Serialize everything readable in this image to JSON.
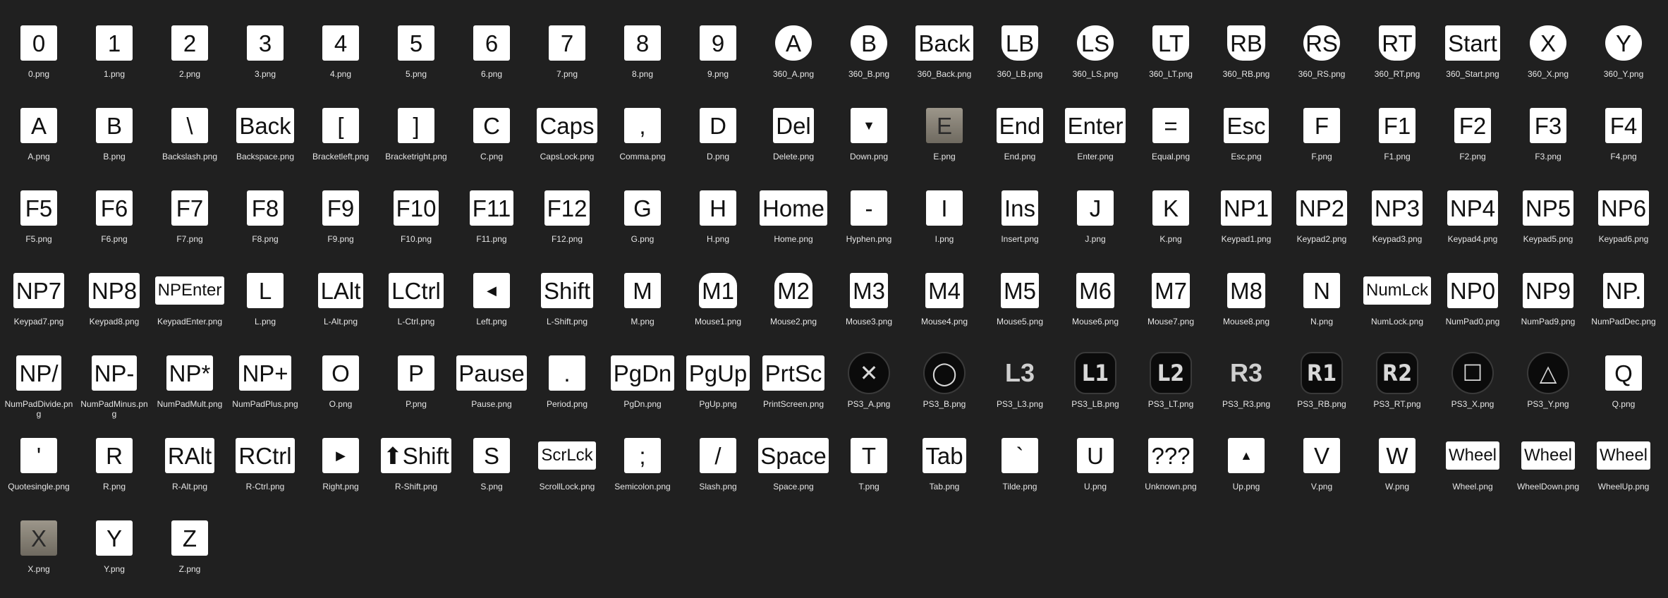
{
  "tiles": [
    {
      "label": "0",
      "file": "0.png"
    },
    {
      "label": "1",
      "file": "1.png"
    },
    {
      "label": "2",
      "file": "2.png"
    },
    {
      "label": "3",
      "file": "3.png"
    },
    {
      "label": "4",
      "file": "4.png"
    },
    {
      "label": "5",
      "file": "5.png"
    },
    {
      "label": "6",
      "file": "6.png"
    },
    {
      "label": "7",
      "file": "7.png"
    },
    {
      "label": "8",
      "file": "8.png"
    },
    {
      "label": "9",
      "file": "9.png"
    },
    {
      "label": "A",
      "file": "360_A.png",
      "style": "round"
    },
    {
      "label": "B",
      "file": "360_B.png",
      "style": "round"
    },
    {
      "label": "Back",
      "file": "360_Back.png"
    },
    {
      "label": "LB",
      "file": "360_LB.png",
      "style": "shield"
    },
    {
      "label": "LS",
      "file": "360_LS.png",
      "style": "round"
    },
    {
      "label": "LT",
      "file": "360_LT.png",
      "style": "shield"
    },
    {
      "label": "RB",
      "file": "360_RB.png",
      "style": "shield"
    },
    {
      "label": "RS",
      "file": "360_RS.png",
      "style": "round"
    },
    {
      "label": "RT",
      "file": "360_RT.png",
      "style": "shield"
    },
    {
      "label": "Start",
      "file": "360_Start.png"
    },
    {
      "label": "X",
      "file": "360_X.png",
      "style": "round"
    },
    {
      "label": "Y",
      "file": "360_Y.png",
      "style": "round"
    },
    {
      "label": "A",
      "file": "A.png"
    },
    {
      "label": "B",
      "file": "B.png"
    },
    {
      "label": "\\",
      "file": "Backslash.png"
    },
    {
      "label": "Back",
      "file": "Backspace.png"
    },
    {
      "label": "[",
      "file": "Bracketleft.png"
    },
    {
      "label": "]",
      "file": "Bracketright.png"
    },
    {
      "label": "C",
      "file": "C.png"
    },
    {
      "label": "Caps",
      "file": "CapsLock.png"
    },
    {
      "label": ",",
      "file": "Comma.png"
    },
    {
      "label": "D",
      "file": "D.png"
    },
    {
      "label": "Del",
      "file": "Delete.png"
    },
    {
      "label": "▼",
      "file": "Down.png",
      "style": "arrow"
    },
    {
      "label": "E",
      "file": "E.png",
      "style": "dim"
    },
    {
      "label": "End",
      "file": "End.png"
    },
    {
      "label": "Enter",
      "file": "Enter.png"
    },
    {
      "label": "=",
      "file": "Equal.png"
    },
    {
      "label": "Esc",
      "file": "Esc.png"
    },
    {
      "label": "F",
      "file": "F.png"
    },
    {
      "label": "F1",
      "file": "F1.png"
    },
    {
      "label": "F2",
      "file": "F2.png"
    },
    {
      "label": "F3",
      "file": "F3.png"
    },
    {
      "label": "F4",
      "file": "F4.png"
    },
    {
      "label": "F5",
      "file": "F5.png"
    },
    {
      "label": "F6",
      "file": "F6.png"
    },
    {
      "label": "F7",
      "file": "F7.png"
    },
    {
      "label": "F8",
      "file": "F8.png"
    },
    {
      "label": "F9",
      "file": "F9.png"
    },
    {
      "label": "F10",
      "file": "F10.png"
    },
    {
      "label": "F11",
      "file": "F11.png"
    },
    {
      "label": "F12",
      "file": "F12.png"
    },
    {
      "label": "G",
      "file": "G.png"
    },
    {
      "label": "H",
      "file": "H.png"
    },
    {
      "label": "Home",
      "file": "Home.png"
    },
    {
      "label": "-",
      "file": "Hyphen.png"
    },
    {
      "label": "I",
      "file": "I.png"
    },
    {
      "label": "Ins",
      "file": "Insert.png"
    },
    {
      "label": "J",
      "file": "J.png"
    },
    {
      "label": "K",
      "file": "K.png"
    },
    {
      "label": "NP1",
      "file": "Keypad1.png"
    },
    {
      "label": "NP2",
      "file": "Keypad2.png"
    },
    {
      "label": "NP3",
      "file": "Keypad3.png"
    },
    {
      "label": "NP4",
      "file": "Keypad4.png"
    },
    {
      "label": "NP5",
      "file": "Keypad5.png"
    },
    {
      "label": "NP6",
      "file": "Keypad6.png"
    },
    {
      "label": "NP7",
      "file": "Keypad7.png"
    },
    {
      "label": "NP8",
      "file": "Keypad8.png"
    },
    {
      "label": "NPEnter",
      "file": "KeypadEnter.png",
      "style": "small"
    },
    {
      "label": "L",
      "file": "L.png"
    },
    {
      "label": "LAlt",
      "file": "L-Alt.png"
    },
    {
      "label": "LCtrl",
      "file": "L-Ctrl.png"
    },
    {
      "label": "◀",
      "file": "Left.png",
      "style": "arrow"
    },
    {
      "label": "Shift",
      "file": "L-Shift.png"
    },
    {
      "label": "M",
      "file": "M.png"
    },
    {
      "label": "M1",
      "file": "Mouse1.png",
      "style": "mouse"
    },
    {
      "label": "M2",
      "file": "Mouse2.png",
      "style": "mouse"
    },
    {
      "label": "M3",
      "file": "Mouse3.png"
    },
    {
      "label": "M4",
      "file": "Mouse4.png"
    },
    {
      "label": "M5",
      "file": "Mouse5.png"
    },
    {
      "label": "M6",
      "file": "Mouse6.png"
    },
    {
      "label": "M7",
      "file": "Mouse7.png"
    },
    {
      "label": "M8",
      "file": "Mouse8.png"
    },
    {
      "label": "N",
      "file": "N.png"
    },
    {
      "label": "NumLck",
      "file": "NumLock.png",
      "style": "small"
    },
    {
      "label": "NP0",
      "file": "NumPad0.png"
    },
    {
      "label": "NP9",
      "file": "NumPad9.png"
    },
    {
      "label": "NP.",
      "file": "NumPadDec.png"
    },
    {
      "label": "NP/",
      "file": "NumPadDivide.png"
    },
    {
      "label": "NP-",
      "file": "NumPadMinus.png"
    },
    {
      "label": "NP*",
      "file": "NumPadMult.png"
    },
    {
      "label": "NP+",
      "file": "NumPadPlus.png"
    },
    {
      "label": "O",
      "file": "O.png"
    },
    {
      "label": "P",
      "file": "P.png"
    },
    {
      "label": "Pause",
      "file": "Pause.png"
    },
    {
      "label": ".",
      "file": "Period.png"
    },
    {
      "label": "PgDn",
      "file": "PgDn.png"
    },
    {
      "label": "PgUp",
      "file": "PgUp.png"
    },
    {
      "label": "PrtSc",
      "file": "PrintScreen.png"
    },
    {
      "label": "✕",
      "file": "PS3_A.png",
      "style": "ps"
    },
    {
      "label": "◯",
      "file": "PS3_B.png",
      "style": "ps"
    },
    {
      "label": "L3",
      "file": "PS3_L3.png",
      "style": "ps-plain"
    },
    {
      "label": "L1",
      "file": "PS3_LB.png",
      "style": "ps-bumper"
    },
    {
      "label": "L2",
      "file": "PS3_LT.png",
      "style": "ps-bumper"
    },
    {
      "label": "R3",
      "file": "PS3_R3.png",
      "style": "ps-plain"
    },
    {
      "label": "R1",
      "file": "PS3_RB.png",
      "style": "ps-bumper"
    },
    {
      "label": "R2",
      "file": "PS3_RT.png",
      "style": "ps-bumper"
    },
    {
      "label": "☐",
      "file": "PS3_X.png",
      "style": "ps"
    },
    {
      "label": "△",
      "file": "PS3_Y.png",
      "style": "ps"
    },
    {
      "label": "Q",
      "file": "Q.png"
    },
    {
      "label": "'",
      "file": "Quotesingle.png"
    },
    {
      "label": "R",
      "file": "R.png"
    },
    {
      "label": "RAlt",
      "file": "R-Alt.png"
    },
    {
      "label": "RCtrl",
      "file": "R-Ctrl.png"
    },
    {
      "label": "▶",
      "file": "Right.png",
      "style": "arrow"
    },
    {
      "label": "⬆Shift",
      "file": "R-Shift.png"
    },
    {
      "label": "S",
      "file": "S.png"
    },
    {
      "label": "ScrLck",
      "file": "ScrollLock.png",
      "style": "small"
    },
    {
      "label": ";",
      "file": "Semicolon.png"
    },
    {
      "label": "/",
      "file": "Slash.png"
    },
    {
      "label": "Space",
      "file": "Space.png"
    },
    {
      "label": "T",
      "file": "T.png"
    },
    {
      "label": "Tab",
      "file": "Tab.png"
    },
    {
      "label": "`",
      "file": "Tilde.png"
    },
    {
      "label": "U",
      "file": "U.png"
    },
    {
      "label": "???",
      "file": "Unknown.png"
    },
    {
      "label": "▲",
      "file": "Up.png",
      "style": "arrow"
    },
    {
      "label": "V",
      "file": "V.png"
    },
    {
      "label": "W",
      "file": "W.png"
    },
    {
      "label": "Wheel",
      "file": "Wheel.png",
      "style": "small"
    },
    {
      "label": "Wheel",
      "file": "WheelDown.png",
      "style": "small"
    },
    {
      "label": "Wheel",
      "file": "WheelUp.png",
      "style": "small"
    },
    {
      "label": "X",
      "file": "X.png",
      "style": "dim"
    },
    {
      "label": "Y",
      "file": "Y.png"
    },
    {
      "label": "Z",
      "file": "Z.png"
    }
  ]
}
